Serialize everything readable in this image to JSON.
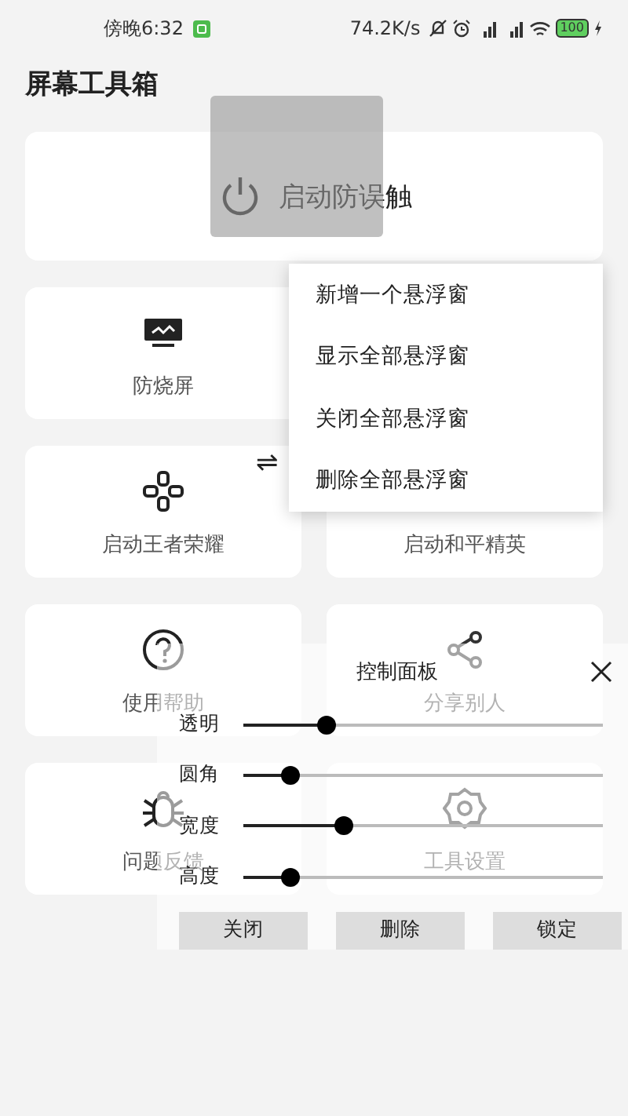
{
  "status_bar": {
    "time": "傍晚6:32",
    "speed": "74.2K/s",
    "battery": "100"
  },
  "title": "屏幕工具箱",
  "main_action": {
    "label": "启动防误触"
  },
  "tools": [
    {
      "label": "防烧屏",
      "kind": "monitor"
    },
    {
      "kind": "blank"
    },
    {
      "label": "启动王者荣耀",
      "kind": "gamepad"
    },
    {
      "label": "启动和平精英",
      "kind": "blank"
    },
    {
      "label": "使用帮助",
      "kind": "help"
    },
    {
      "label": "分享别人",
      "kind": "share"
    },
    {
      "label": "问题反馈",
      "kind": "bug"
    },
    {
      "label": "工具设置",
      "kind": "gear"
    }
  ],
  "swap_icon": "⇌",
  "menu": {
    "items": [
      "新增一个悬浮窗",
      "显示全部悬浮窗",
      "关闭全部悬浮窗",
      "删除全部悬浮窗"
    ]
  },
  "control_panel": {
    "title": "控制面板",
    "sliders": [
      {
        "label": "透明",
        "level": 0.23
      },
      {
        "label": "圆角",
        "level": 0.13
      },
      {
        "label": "宽度",
        "level": 0.28
      },
      {
        "label": "高度",
        "level": 0.13
      }
    ],
    "buttons": [
      "关闭",
      "删除",
      "锁定"
    ]
  }
}
